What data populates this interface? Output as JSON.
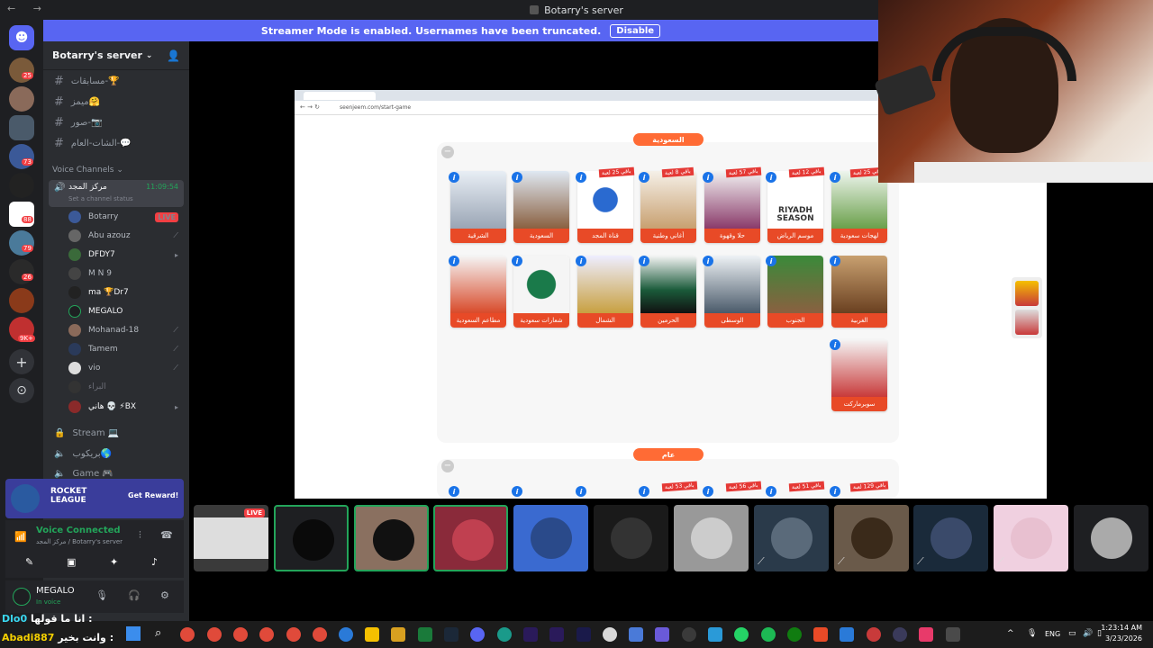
{
  "window": {
    "title": "Botarry's server"
  },
  "banner": {
    "text": "Streamer Mode is enabled. Usernames have been truncated.",
    "button": "Disable"
  },
  "server": {
    "name": "Botarry's server"
  },
  "channels": [
    {
      "name": "مسابقات-🏆"
    },
    {
      "name": "ميمز🤗"
    },
    {
      "name": "صور-📷"
    },
    {
      "name": "الشات-العام-💬"
    }
  ],
  "voice_category": "Voice Channels",
  "voice_channel": {
    "name": "مركز المجد",
    "timer": "11:09:54",
    "status_hint": "Set a channel status"
  },
  "voice_users": [
    {
      "name": "Botarry",
      "badge": "LIVE"
    },
    {
      "name": "Abu azouz"
    },
    {
      "name": "DFDY7"
    },
    {
      "name": "M N 9"
    },
    {
      "name": "ma 🏆Dr7"
    },
    {
      "name": "MEGALO"
    },
    {
      "name": "Mohanad-18"
    },
    {
      "name": "Tamem"
    },
    {
      "name": "vio"
    },
    {
      "name": "البراء"
    },
    {
      "name": "هاني 💀 ⚡BX"
    }
  ],
  "more_channels": [
    {
      "name": "Stream 💻"
    },
    {
      "name": "بريكوب🌎"
    },
    {
      "name": "Game 🎮"
    }
  ],
  "promo": {
    "title": "ROCKET LEAGUE",
    "button": "Get Reward!"
  },
  "voice_panel": {
    "status": "Voice Connected",
    "location": "مركز المجد / Botarry's server"
  },
  "user_panel": {
    "name": "MEGALO",
    "status": "In voice"
  },
  "browser": {
    "url": "seenjeem.com/start-game"
  },
  "game": {
    "section1": "السعودية",
    "section2": "عام",
    "row1": [
      {
        "label": "الشرقية"
      },
      {
        "label": "السعودية"
      },
      {
        "label": "قناة المجد",
        "ribbon": "باقي 25 لعبة"
      },
      {
        "label": "أغاني وطنية",
        "ribbon": "باقي 8 لعبة"
      },
      {
        "label": "حلا وقهوة",
        "ribbon": "باقي 57 لعبة"
      },
      {
        "label": "موسم الرياض",
        "ribbon": "باقي 12 لعبة",
        "pic_text": "RIYADH SEASON"
      },
      {
        "label": "لهجات سعودية",
        "ribbon": "باقي 25 لعبة"
      }
    ],
    "row2": [
      {
        "label": "مطاعم السعودية"
      },
      {
        "label": "شعارات سعودية"
      },
      {
        "label": "الشمال"
      },
      {
        "label": "الحرمين"
      },
      {
        "label": "الوسطى"
      },
      {
        "label": "الجنوب"
      },
      {
        "label": "الغربية"
      }
    ],
    "row3": [
      {
        "label": "سوبرماركت"
      }
    ],
    "row4_ribbons": [
      "باقي 53 لعبة",
      "باقي 56 لعبة",
      "باقي 51 لعبة",
      "باقي 129 لعبة"
    ]
  },
  "stream_tile_badge": "LIVE",
  "chat": [
    {
      "user": "Dlo0",
      "text": "انا ما قولها :"
    },
    {
      "user": "Abadi887",
      "text": "وانت بخير :"
    }
  ],
  "tray": {
    "lang": "ENG",
    "time": "1:23:14 AM",
    "date": "3/23/2026"
  },
  "rail_badges": [
    "25",
    "73",
    "88",
    "79",
    "26",
    "9K+"
  ]
}
